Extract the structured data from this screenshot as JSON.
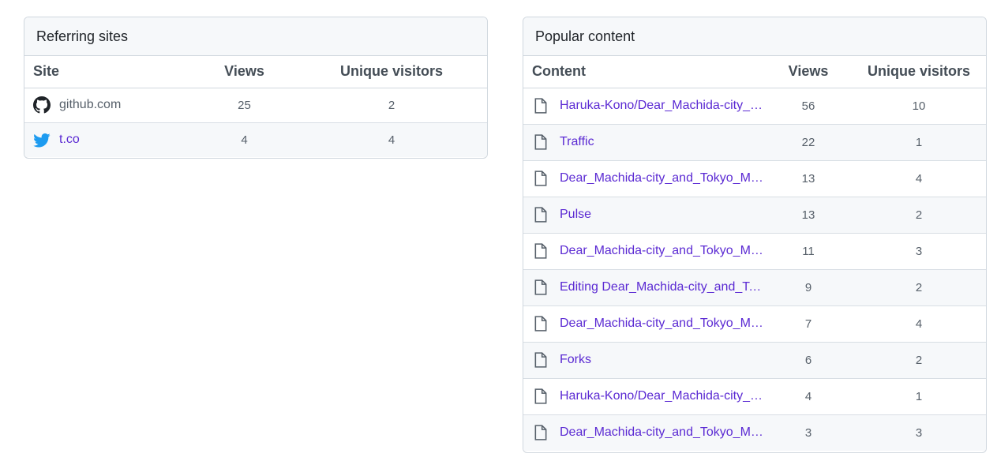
{
  "referring_sites": {
    "title": "Referring sites",
    "columns": {
      "site": "Site",
      "views": "Views",
      "unique": "Unique visitors"
    },
    "rows": [
      {
        "site": "github.com",
        "icon": "github-icon",
        "views": "25",
        "unique": "2"
      },
      {
        "site": "t.co",
        "icon": "twitter-icon",
        "views": "4",
        "unique": "4"
      }
    ]
  },
  "popular_content": {
    "title": "Popular content",
    "columns": {
      "content": "Content",
      "views": "Views",
      "unique": "Unique visitors"
    },
    "rows": [
      {
        "content": "Haruka-Kono/Dear_Machida-city_a…",
        "views": "56",
        "unique": "10"
      },
      {
        "content": "Traffic",
        "views": "22",
        "unique": "1"
      },
      {
        "content": "Dear_Machida-city_and_Tokyo_Me…",
        "views": "13",
        "unique": "4"
      },
      {
        "content": "Pulse",
        "views": "13",
        "unique": "2"
      },
      {
        "content": "Dear_Machida-city_and_Tokyo_Me…",
        "views": "11",
        "unique": "3"
      },
      {
        "content": "Editing Dear_Machida-city_and_To…",
        "views": "9",
        "unique": "2"
      },
      {
        "content": "Dear_Machida-city_and_Tokyo_Me…",
        "views": "7",
        "unique": "4"
      },
      {
        "content": "Forks",
        "views": "6",
        "unique": "2"
      },
      {
        "content": "Haruka-Kono/Dear_Machida-city_a…",
        "views": "4",
        "unique": "1"
      },
      {
        "content": "Dear_Machida-city_and_Tokyo_Me…",
        "views": "3",
        "unique": "3"
      }
    ]
  },
  "colors": {
    "link": "#5b2ad3",
    "twitter": "#1d9bf0",
    "border": "#d0d7de",
    "header_bg": "#f6f8fa"
  }
}
